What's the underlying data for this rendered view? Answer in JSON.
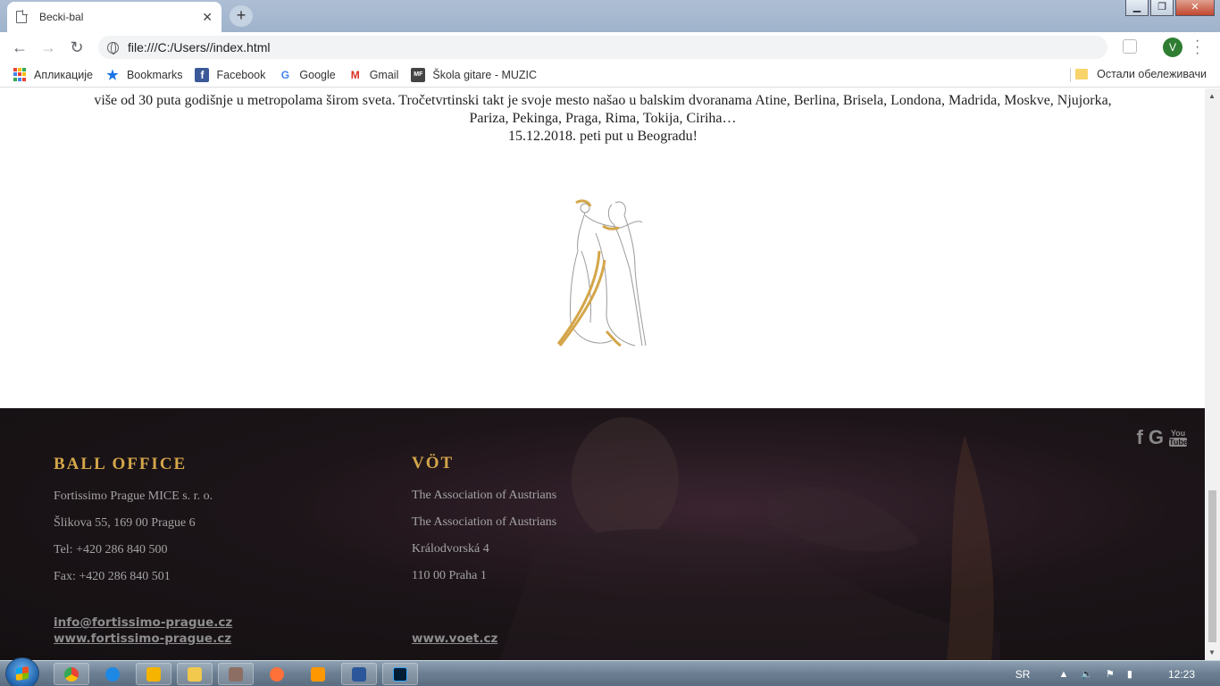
{
  "browser": {
    "tab_title": "Becki-bal",
    "new_tab": "+",
    "close_tab": "✕",
    "url": "file:///C:/Users//index.html",
    "profile_initial": "V",
    "window_controls": {
      "minimize": "▁",
      "maximize": "❐",
      "close": "✕"
    }
  },
  "bookmarks": {
    "items": [
      {
        "label": "Апликације",
        "icon": "apps-icon"
      },
      {
        "label": "Bookmarks",
        "icon": "star-icon"
      },
      {
        "label": "Facebook",
        "icon": "facebook-icon"
      },
      {
        "label": "Google",
        "icon": "google-icon"
      },
      {
        "label": "Gmail",
        "icon": "gmail-icon"
      },
      {
        "label": "Škola gitare - MUZIC",
        "icon": "mf-icon"
      }
    ],
    "other": "Остали обележивачи"
  },
  "page": {
    "intro_line1": "više od 30 puta godišnje u metropolama širom sveta. Tročetvrtinski takt je svoje mesto našao u balskim dvoranama Atine, Berlina, Brisela, Londona, Madrida, Moskve, Njujorka,",
    "intro_line2": "Pariza, Pekinga, Praga, Rima, Tokija, Ciriha…",
    "intro_line3": "15.12.2018. peti put u Beogradu!"
  },
  "footer": {
    "col1": {
      "title": "BALL OFFICE",
      "lines": [
        "Fortissimo Prague MICE s. r. o.",
        "Šlikova 55, 169 00 Prague 6",
        "Tel: +420 286 840 500",
        "Fax: +420 286 840 501"
      ],
      "email": "info@fortissimo-prague.cz",
      "website": "www.fortissimo-prague.cz"
    },
    "col2": {
      "title": "VÖT",
      "lines": [
        "The Association of Austrians",
        "The Association of Austrians",
        "Králodvorská 4",
        "110 00 Praha 1"
      ],
      "website": "www.voet.cz"
    },
    "social": {
      "facebook": "f",
      "google": "G",
      "youtube_top": "You",
      "youtube_bottom": "Tube"
    }
  },
  "taskbar": {
    "lang": "SR",
    "time": "12:23",
    "apps": [
      "chrome",
      "internet-explorer",
      "winamp",
      "file-explorer",
      "calculator",
      "firefox",
      "media-player",
      "word",
      "photoshop"
    ]
  },
  "colors": {
    "accent_gold": "#d4a64a",
    "footer_bg": "#1c1418"
  }
}
